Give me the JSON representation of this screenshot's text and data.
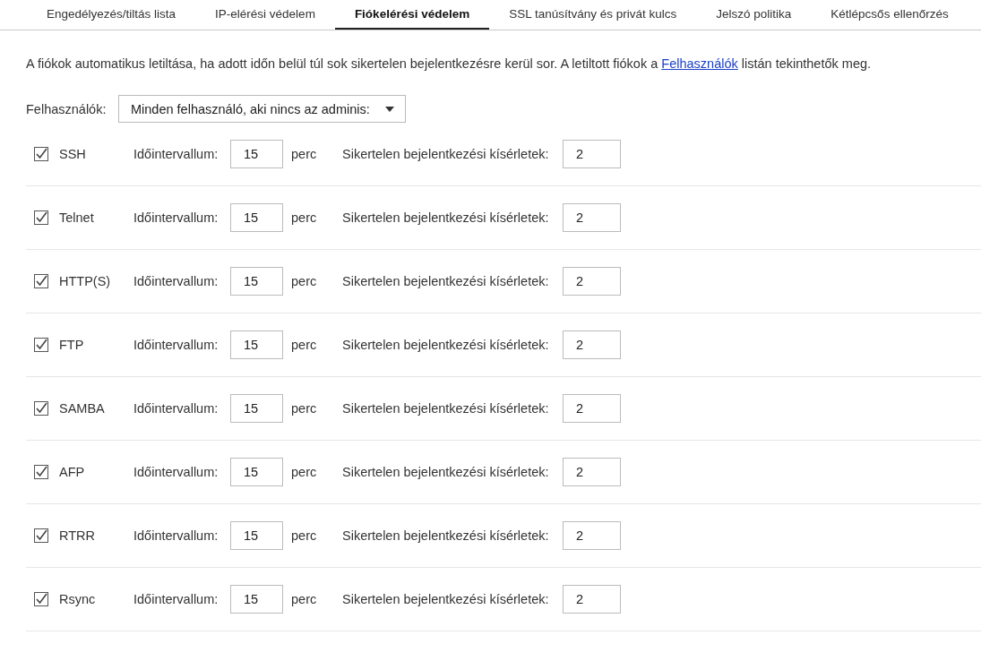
{
  "tabs": [
    {
      "label": "Engedélyezés/tiltás lista",
      "selected": false
    },
    {
      "label": "IP-elérési védelem",
      "selected": false
    },
    {
      "label": "Fiókelérési védelem",
      "selected": true
    },
    {
      "label": "SSL tanúsítvány és privát kulcs",
      "selected": false
    },
    {
      "label": "Jelszó politika",
      "selected": false
    },
    {
      "label": "Kétlépcsős ellenőrzés",
      "selected": false
    }
  ],
  "description": {
    "before": "A fiókok automatikus letiltása, ha adott időn belül túl sok sikertelen bejelentkezésre kerül sor. A letiltott fiókok a",
    "link": "Felhasználók",
    "after": "listán tekinthetők meg."
  },
  "users": {
    "label": "Felhasználók:",
    "value": "Minden felhasználó, aki nincs az adminis:"
  },
  "protocols": [
    {
      "name": "SSH",
      "checked": true,
      "interval_label": "Időintervallum:",
      "interval": "15",
      "unit": "perc",
      "attempts_label": "Sikertelen bejelentkezési kísérletek:",
      "attempts": "2"
    },
    {
      "name": "Telnet",
      "checked": true,
      "interval_label": "Időintervallum:",
      "interval": "15",
      "unit": "perc",
      "attempts_label": "Sikertelen bejelentkezési kísérletek:",
      "attempts": "2"
    },
    {
      "name": "HTTP(S)",
      "checked": true,
      "interval_label": "Időintervallum:",
      "interval": "15",
      "unit": "perc",
      "attempts_label": "Sikertelen bejelentkezési kísérletek:",
      "attempts": "2"
    },
    {
      "name": "FTP",
      "checked": true,
      "interval_label": "Időintervallum:",
      "interval": "15",
      "unit": "perc",
      "attempts_label": "Sikertelen bejelentkezési kísérletek:",
      "attempts": "2"
    },
    {
      "name": "SAMBA",
      "checked": true,
      "interval_label": "Időintervallum:",
      "interval": "15",
      "unit": "perc",
      "attempts_label": "Sikertelen bejelentkezési kísérletek:",
      "attempts": "2"
    },
    {
      "name": "AFP",
      "checked": true,
      "interval_label": "Időintervallum:",
      "interval": "15",
      "unit": "perc",
      "attempts_label": "Sikertelen bejelentkezési kísérletek:",
      "attempts": "2"
    },
    {
      "name": "RTRR",
      "checked": true,
      "interval_label": "Időintervallum:",
      "interval": "15",
      "unit": "perc",
      "attempts_label": "Sikertelen bejelentkezési kísérletek:",
      "attempts": "2"
    },
    {
      "name": "Rsync",
      "checked": true,
      "interval_label": "Időintervallum:",
      "interval": "15",
      "unit": "perc",
      "attempts_label": "Sikertelen bejelentkezési kísérletek:",
      "attempts": "2"
    }
  ]
}
